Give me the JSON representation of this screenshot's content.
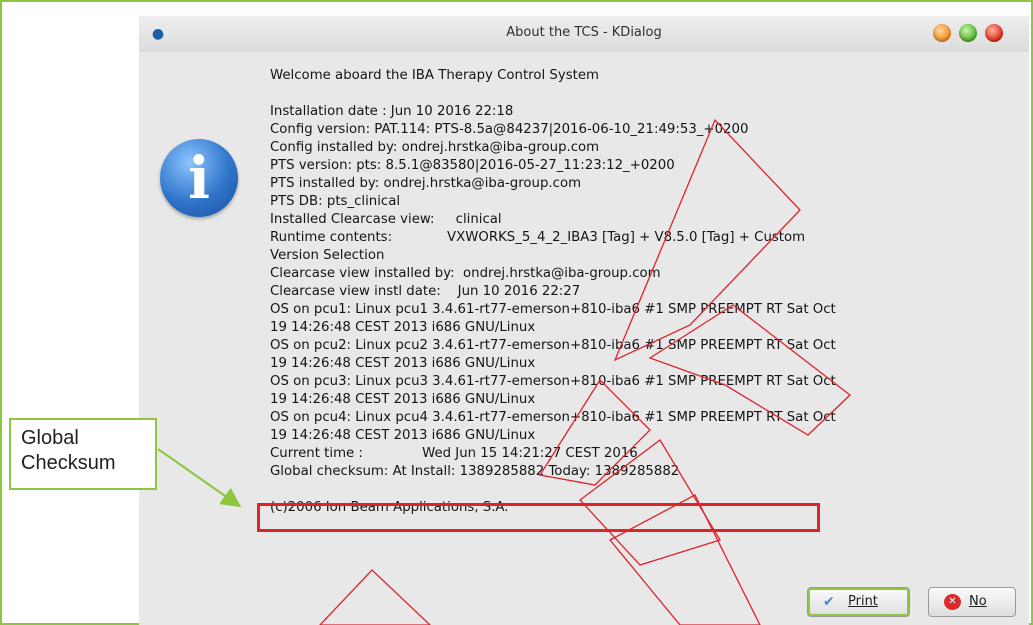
{
  "window": {
    "title": "About the TCS - KDialog",
    "app_icon": "kdialog-icon",
    "info_icon": "information-icon",
    "info_glyph": "i"
  },
  "content": {
    "welcome": "Welcome aboard the IBA Therapy Control System",
    "lines": [
      "Installation date : Jun 10 2016 22:18",
      "Config version: PAT.114: PTS-8.5a@84237|2016-06-10_21:49:53_+0200",
      "Config installed by: ondrej.hrstka@iba-group.com",
      "PTS version: pts: 8.5.1@83580|2016-05-27_11:23:12_+0200",
      "PTS installed by: ondrej.hrstka@iba-group.com",
      "PTS DB: pts_clinical",
      "Installed Clearcase view:     clinical",
      "Runtime contents:             VXWORKS_5_4_2_IBA3 [Tag] + V8.5.0 [Tag] + Custom",
      "Version Selection",
      "Clearcase view installed by:  ondrej.hrstka@iba-group.com",
      "Clearcase view instl date:    Jun 10 2016 22:27",
      "OS on pcu1: Linux pcu1 3.4.61-rt77-emerson+810-iba6 #1 SMP PREEMPT RT Sat Oct",
      "19 14:26:48 CEST 2013 i686 GNU/Linux",
      "OS on pcu2: Linux pcu2 3.4.61-rt77-emerson+810-iba6 #1 SMP PREEMPT RT Sat Oct",
      "19 14:26:48 CEST 2013 i686 GNU/Linux",
      "OS on pcu3: Linux pcu3 3.4.61-rt77-emerson+810-iba6 #1 SMP PREEMPT RT Sat Oct",
      "19 14:26:48 CEST 2013 i686 GNU/Linux",
      "OS on pcu4: Linux pcu4 3.4.61-rt77-emerson+810-iba6 #1 SMP PREEMPT RT Sat Oct",
      "19 14:26:48 CEST 2013 i686 GNU/Linux",
      "Current time :              Wed Jun 15 14:21:27 CEST 2016",
      "Global checksum: At Install: 1389285882 Today: 1389285882"
    ],
    "copyright": "(c)2006 Ion Beam Applications, S.A."
  },
  "buttons": {
    "print_label": "Print",
    "print_icon": "checkmark-icon",
    "no_label": "No",
    "no_icon": "cancel-icon"
  },
  "annotation": {
    "callout_line1": "Global",
    "callout_line2": "Checksum",
    "highlight_color": "#e0222a",
    "callout_border_color": "#8dc63f",
    "arrow_color": "#8dc63f"
  }
}
